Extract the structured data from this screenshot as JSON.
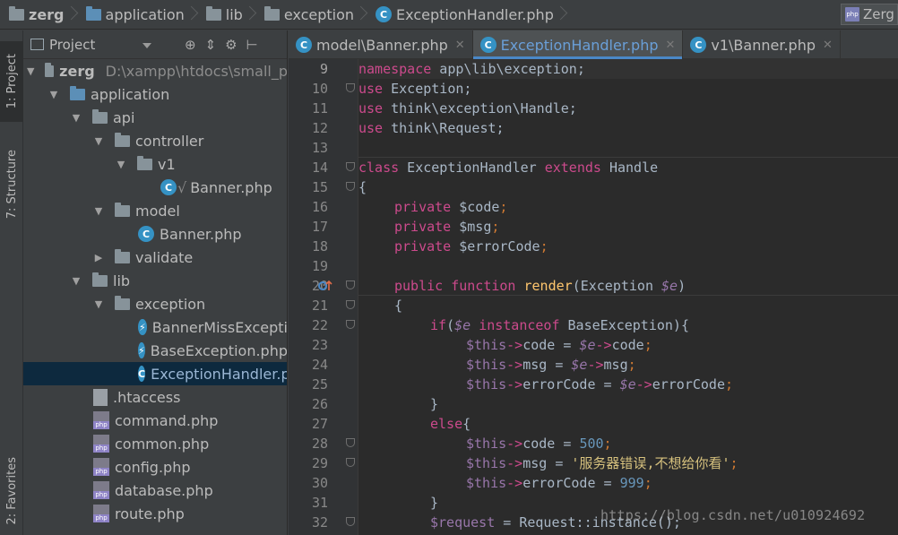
{
  "breadcrumb": {
    "items": [
      {
        "label": "zerg",
        "icon": "folder-icon"
      },
      {
        "label": "application",
        "icon": "folder-icon"
      },
      {
        "label": "lib",
        "icon": "folder-icon"
      },
      {
        "label": "exception",
        "icon": "folder-icon"
      },
      {
        "label": "ExceptionHandler.php",
        "icon": "php-class-icon"
      }
    ],
    "run_config": "Zerg"
  },
  "tool_stripe": {
    "project_tab": "1: Project",
    "structure_tab": "7: Structure",
    "favorites_tab": "2: Favorites"
  },
  "project_panel": {
    "title": "Project",
    "tree": [
      {
        "label": "zerg",
        "path": "D:\\xampp\\htdocs\\small_p",
        "type": "folder",
        "expanded": true
      },
      {
        "label": "application",
        "type": "folder",
        "expanded": true
      },
      {
        "label": "api",
        "type": "folder",
        "expanded": true
      },
      {
        "label": "controller",
        "type": "folder",
        "expanded": true
      },
      {
        "label": "v1",
        "type": "folder",
        "expanded": true
      },
      {
        "label": "Banner.php",
        "type": "php-class"
      },
      {
        "label": "model",
        "type": "folder",
        "expanded": true
      },
      {
        "label": "Banner.php",
        "type": "php-class"
      },
      {
        "label": "validate",
        "type": "folder",
        "expanded": false
      },
      {
        "label": "lib",
        "type": "folder",
        "expanded": true
      },
      {
        "label": "exception",
        "type": "folder",
        "expanded": true
      },
      {
        "label": "BannerMissExcepti",
        "type": "php-exception"
      },
      {
        "label": "BaseException.php",
        "type": "php-exception"
      },
      {
        "label": "ExceptionHandler.p",
        "type": "php-class",
        "selected": true
      },
      {
        "label": ".htaccess",
        "type": "file"
      },
      {
        "label": "command.php",
        "type": "php"
      },
      {
        "label": "common.php",
        "type": "php"
      },
      {
        "label": "config.php",
        "type": "php"
      },
      {
        "label": "database.php",
        "type": "php"
      },
      {
        "label": "route.php",
        "type": "php"
      }
    ]
  },
  "editor": {
    "tabs": [
      {
        "label": "model\\Banner.php",
        "active": false
      },
      {
        "label": "ExceptionHandler.php",
        "active": true
      },
      {
        "label": "v1\\Banner.php",
        "active": false
      }
    ],
    "line_numbers": [
      "9",
      "10",
      "11",
      "12",
      "13",
      "14",
      "15",
      "16",
      "17",
      "18",
      "19",
      "20",
      "21",
      "22",
      "23",
      "24",
      "25",
      "26",
      "27",
      "28",
      "29",
      "30",
      "31",
      "32"
    ],
    "code_text": {
      "l9_kw": "namespace",
      "l9_rest": " app\\lib\\exception;",
      "l10_kw": "use",
      "l10_rest": " Exception;",
      "l11_kw": "use",
      "l11_rest": " think\\exception\\Handle;",
      "l12_kw": "use",
      "l12_rest": " think\\Request;",
      "l14_kw": "class",
      "l14_name": " ExceptionHandler ",
      "l14_kw2": "extends",
      "l14_rest": " Handle",
      "l15": "{",
      "l16_kw": "private",
      "l16_var": "$code",
      "l17_kw": "private",
      "l17_var": "$msg",
      "l18_kw": "private",
      "l18_var": "$errorCode",
      "l20_kw": "public",
      "l20_kw2": "function",
      "l20_fn": "render",
      "l20_a": "(Exception ",
      "l20_var": "$e",
      "l20_b": ")",
      "l21": "{",
      "l22_kw": "if",
      "l22_var": "$e",
      "l22_kw2": "instanceof",
      "l22_rest": " BaseException){",
      "this": "$this",
      "arrow": "->",
      "code": "code",
      "msg": "msg",
      "errorCode": "errorCode",
      "e": "$e",
      "eq": " = ",
      "semi": ";",
      "l26": "}",
      "l27_kw": "else",
      "l27_rest": "{",
      "l28_num": "500",
      "l29_str": "'服务器错误,不想给你看'",
      "l30_num": "999",
      "l31": "}",
      "l32_var": "$request",
      "l32_rest": " = Request::instance();"
    }
  },
  "watermark": "https://blog.csdn.net/u010924692",
  "colors": {
    "editor_bg": "#2b2b2b",
    "keyword": "#cc7832",
    "variable": "#9876aa",
    "function": "#ffc66d",
    "number": "#6897bb",
    "string": "#6a8759"
  }
}
